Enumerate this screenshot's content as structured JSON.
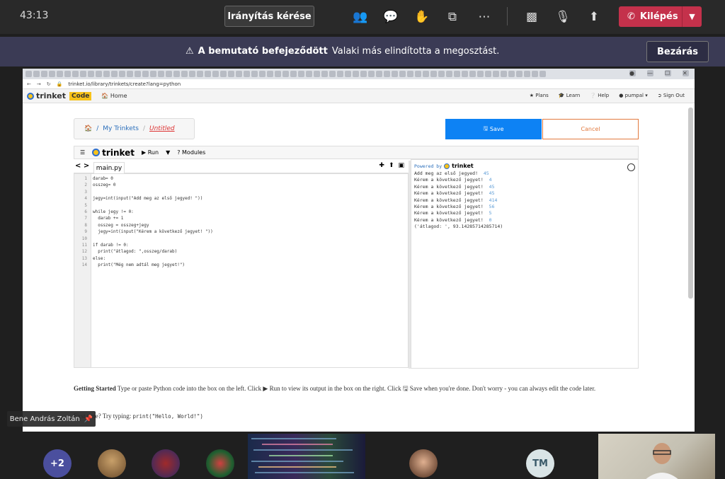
{
  "teams": {
    "timer": "43:13",
    "control_request": "Irányítás kérése",
    "leave": "Kilépés",
    "banner_title": "A bemutató befejeződött",
    "banner_text": "Valaki más elindította a megosztást.",
    "close": "Bezárás",
    "presenter_name": "Bene András Zoltán",
    "more_participants": "+2",
    "tm_initials": "TM",
    "colors": {
      "leave": "#c4314b",
      "banner": "#3b3b55",
      "bar": "#292929"
    }
  },
  "browser": {
    "url": "trinket.io/library/trinkets/create?lang=python"
  },
  "trinket": {
    "brand": "trinket",
    "code_badge": "Code",
    "home": "Home",
    "plans": "Plans",
    "learn": "Learn",
    "help": "Help",
    "user": "pumpal",
    "sign_out": "Sign Out",
    "breadcrumb_root": "My Trinkets",
    "breadcrumb_current": "Untitled",
    "save": "Save",
    "cancel": "Cancel",
    "run": "Run",
    "modules": "Modules",
    "file_tab": "main.py",
    "powered_by": "Powered by",
    "code_lines": [
      {
        "n": "1",
        "t": "darab= 0"
      },
      {
        "n": "2",
        "t": "osszeg= 0"
      },
      {
        "n": "3",
        "t": ""
      },
      {
        "n": "4",
        "t": "jegy=int(input(\"Add meg az első jegyed! \"))"
      },
      {
        "n": "5",
        "t": ""
      },
      {
        "n": "6",
        "t": "while jegy != 0:"
      },
      {
        "n": "7",
        "t": "  darab += 1"
      },
      {
        "n": "8",
        "t": "  osszeg = osszeg+jegy"
      },
      {
        "n": "9",
        "t": "  jegy=int(input(\"Kérem a következő jegyet! \"))"
      },
      {
        "n": "10",
        "t": ""
      },
      {
        "n": "11",
        "t": "if darab != 0:"
      },
      {
        "n": "12",
        "t": "  print(\"átlagod: \",osszeg/darab)"
      },
      {
        "n": "13",
        "t": "else:"
      },
      {
        "n": "14",
        "t": "  print(\"Még nem adtál meg jegyet!\")"
      }
    ],
    "output_lines": [
      {
        "p": "Add meg az első jegyed!",
        "v": "45"
      },
      {
        "p": "Kérem a következő jegyet!",
        "v": "4"
      },
      {
        "p": "Kérem a következő jegyet!",
        "v": "45"
      },
      {
        "p": "Kérem a következő jegyet!",
        "v": "45"
      },
      {
        "p": "Kérem a következő jegyet!",
        "v": "414"
      },
      {
        "p": "Kérem a következő jegyet!",
        "v": "56"
      },
      {
        "p": "Kérem a következő jegyet!",
        "v": "5"
      },
      {
        "p": "Kérem a következő jegyet!",
        "v": "0"
      },
      {
        "p": "('átlagod: ', 93.14285714285714)",
        "v": ""
      }
    ],
    "getting_started_title": "Getting Started",
    "getting_started_text": "Type or paste Python code into the box on the left. Click ▶ Run to view its output in the box on the right. Click 🖫 Save when you're done. Don't worry - you can always edit the code later.",
    "first_time": "First time? Try typing:",
    "first_time_code": "print(\"Hello, World!\")"
  }
}
